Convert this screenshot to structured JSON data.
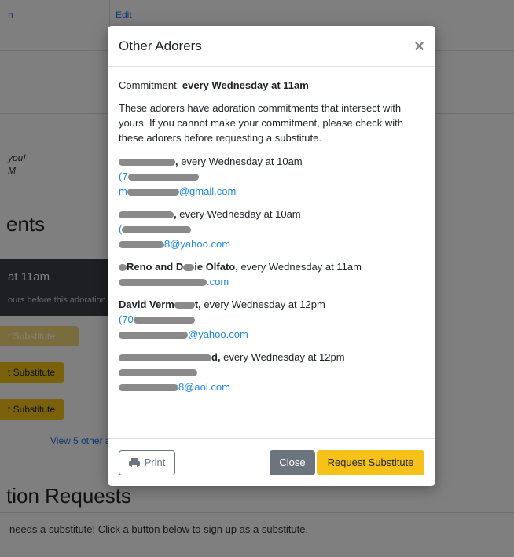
{
  "background": {
    "top_left_link": "n",
    "edit_link": "Edit",
    "italic_line1": "you!",
    "italic_line2": "M",
    "section_heading": "ents",
    "dark_card_title": "at 11am",
    "dark_card_sub": "ours before this adoration",
    "btn1": "t Substitute",
    "btn2": "t Substitute",
    "btn3": "t Substitute",
    "view_other": "View 5 other a",
    "section2_heading": "tion Requests",
    "footer_text": "needs a substitute! Click a button below to sign up as a substitute."
  },
  "modal": {
    "title": "Other Adorers",
    "close_symbol": "×",
    "commitment_label": "Commitment: ",
    "commitment_value": "every Wednesday at 11am",
    "intro": "These adorers have adoration commitments that intersect with yours. If you cannot make your commitment, please check with these adorers before requesting a substitute.",
    "adorers": [
      {
        "name_visible": "",
        "name_tail": ",",
        "schedule": " every Wednesday at 10am",
        "phone_visible": "(7",
        "email_visible": "m",
        "email_tail": "@gmail.com"
      },
      {
        "name_visible": "",
        "name_tail": ",",
        "schedule": " every Wednesday at 10am",
        "phone_visible": "(",
        "email_visible": "",
        "email_tail": "8@yahoo.com"
      },
      {
        "name_visible": "Reno and D",
        "name_tail": "ie Olfato,",
        "schedule": " every Wednesday at 11am",
        "phone_visible": "",
        "email_visible": "",
        "email_tail": ".com"
      },
      {
        "name_visible": "David Verm",
        "name_tail": "t,",
        "schedule": " every Wednesday at 12pm",
        "phone_visible": "(70",
        "email_visible": "",
        "email_tail": "@yahoo.com"
      },
      {
        "name_visible": "",
        "name_tail": "d,",
        "schedule": " every Wednesday at 12pm",
        "phone_visible": "",
        "email_visible": "",
        "email_tail": "8@aol.com"
      }
    ],
    "footer": {
      "print_label": "Print",
      "close_label": "Close",
      "request_label": "Request Substitute"
    }
  }
}
